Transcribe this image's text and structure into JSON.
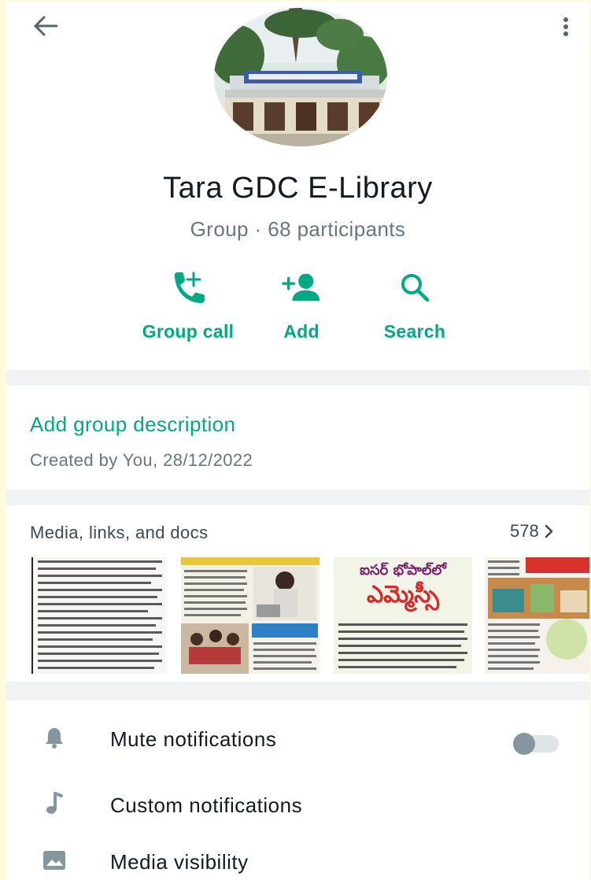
{
  "profile": {
    "group_name": "Tara GDC E-Library",
    "meta": "Group · 68 participants"
  },
  "actions": [
    {
      "label": "Group call",
      "icon": "add-call-icon"
    },
    {
      "label": "Add",
      "icon": "add-person-icon"
    },
    {
      "label": "Search",
      "icon": "search-icon"
    }
  ],
  "description": {
    "add_label": "Add group description",
    "created": "Created by You, 28/12/2022"
  },
  "media": {
    "title": "Media, links, and docs",
    "count": "578",
    "thumb3_headline_1": "ఐసర్ భోపాల్‌లో",
    "thumb3_headline_2": "ఎమ్మెస్సీ"
  },
  "settings": {
    "mute": "Mute notifications",
    "mute_enabled": false,
    "custom": "Custom notifications",
    "visibility": "Media visibility"
  },
  "colors": {
    "accent": "#00a884",
    "secondary_text": "#667781",
    "primary_text": "#111b21",
    "divider_bg": "#f0f2f3"
  }
}
